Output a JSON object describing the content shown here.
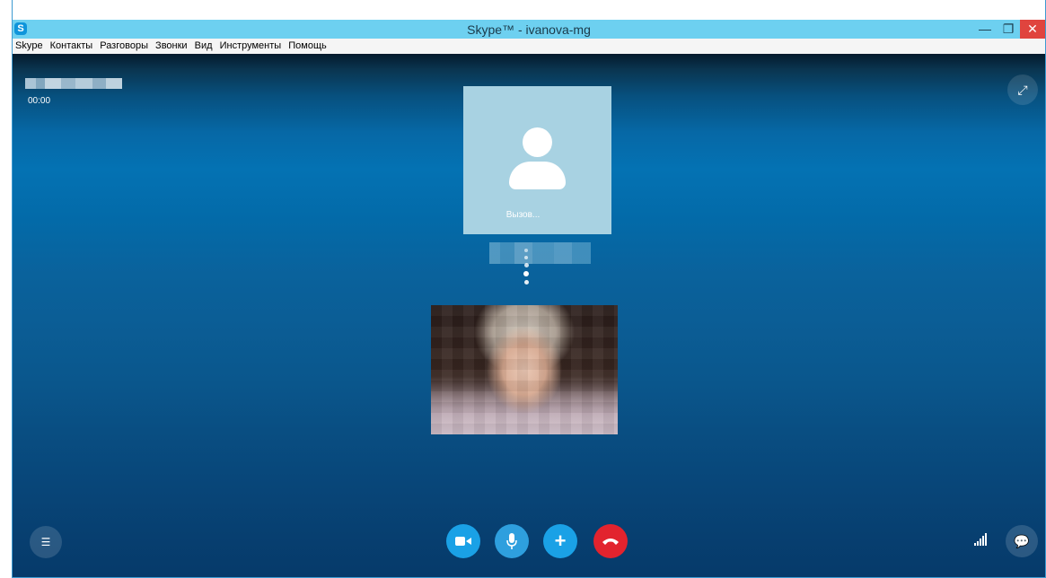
{
  "window": {
    "title": "Skype™ - ivanova-mg",
    "logo_glyph": "S",
    "minimize_glyph": "—",
    "maximize_glyph": "❐",
    "close_glyph": "✕"
  },
  "menu": {
    "items": [
      "Skype",
      "Контакты",
      "Разговоры",
      "Звонки",
      "Вид",
      "Инструменты",
      "Помощь"
    ]
  },
  "call": {
    "timer": "00:00",
    "status": "Вызов...",
    "accent_color": "#1aa1e6",
    "end_call_color": "#e2232e"
  },
  "controls": {
    "video_icon": "video-camera-icon",
    "mic_icon": "microphone-icon",
    "add_icon": "plus-icon",
    "end_icon": "end-call-icon",
    "list_icon": "list-icon",
    "signal_icon": "signal-strength-icon",
    "chat_icon": "chat-bubble-icon",
    "fullscreen_icon": "fullscreen-icon"
  }
}
